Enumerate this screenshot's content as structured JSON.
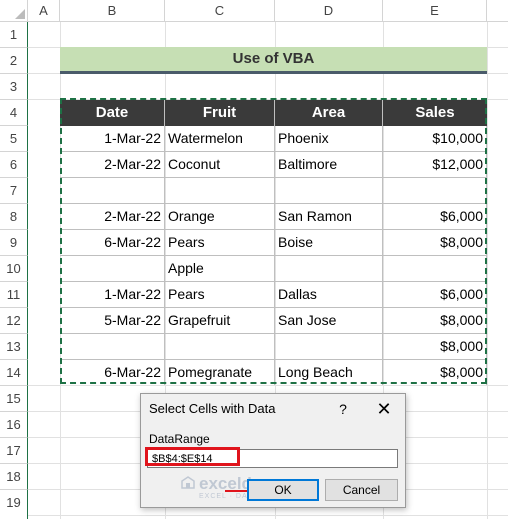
{
  "columns": [
    "A",
    "B",
    "C",
    "D",
    "E"
  ],
  "rows": [
    "1",
    "2",
    "3",
    "4",
    "5",
    "6",
    "7",
    "8",
    "9",
    "10",
    "11",
    "12",
    "13",
    "14",
    "15",
    "16",
    "17",
    "18",
    "19"
  ],
  "title": "Use of VBA",
  "table": {
    "headers": [
      "Date",
      "Fruit",
      "Area",
      "Sales"
    ],
    "rows": [
      [
        "1-Mar-22",
        "Watermelon",
        "Phoenix",
        "$10,000"
      ],
      [
        "2-Mar-22",
        "Coconut",
        "Baltimore",
        "$12,000"
      ],
      [
        "",
        "",
        "",
        ""
      ],
      [
        "2-Mar-22",
        "Orange",
        "San Ramon",
        "$6,000"
      ],
      [
        "6-Mar-22",
        "Pears",
        "Boise",
        "$8,000"
      ],
      [
        "",
        "Apple",
        "",
        ""
      ],
      [
        "1-Mar-22",
        "Pears",
        "Dallas",
        "$6,000"
      ],
      [
        "5-Mar-22",
        "Grapefruit",
        "San Jose",
        "$8,000"
      ],
      [
        "",
        "",
        "",
        "$8,000"
      ],
      [
        "6-Mar-22",
        "Pomegranate",
        "Long Beach",
        "$8,000"
      ]
    ]
  },
  "dialog": {
    "title": "Select Cells with Data",
    "help": "?",
    "close": "✕",
    "label": "DataRange",
    "input_value": "$B$4:$E$14",
    "ok_label": "OK",
    "cancel_label": "Cancel"
  },
  "watermark": {
    "name": "exceldemy",
    "tagline": "EXCEL · DATA · BI"
  },
  "colors": {
    "title_band": "#c6dfb4",
    "header_bg": "#3a3a3a",
    "selection": "#1e7145",
    "highlight": "#e0141c"
  }
}
